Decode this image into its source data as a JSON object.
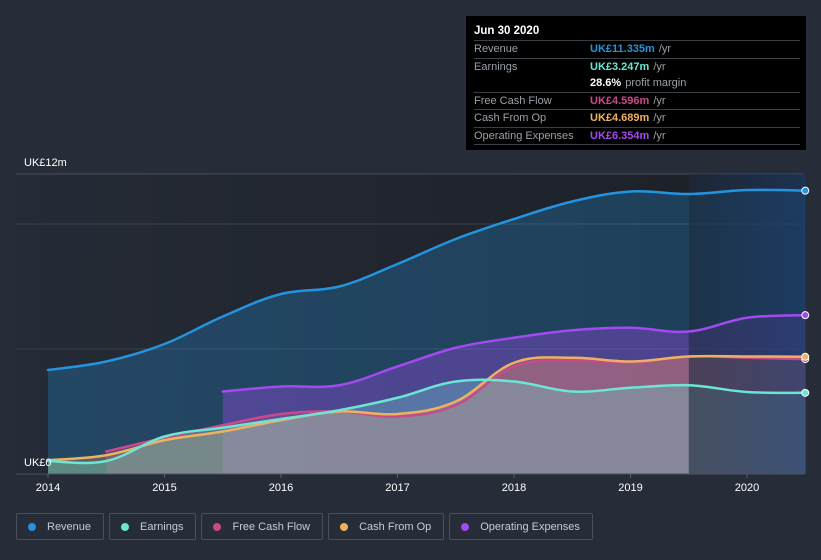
{
  "tooltip": {
    "date": "Jun 30 2020",
    "rows": [
      {
        "label": "Revenue",
        "value": "UK£11.335m",
        "unit": "/yr",
        "color": "#2394df"
      },
      {
        "label": "Earnings",
        "value": "UK£3.247m",
        "unit": "/yr",
        "color": "#6ce5d5"
      },
      {
        "label": "",
        "value": "28.6%",
        "unit": "profit margin",
        "color": "#ffffff"
      },
      {
        "label": "Free Cash Flow",
        "value": "UK£4.596m",
        "unit": "/yr",
        "color": "#c94a8c"
      },
      {
        "label": "Cash From Op",
        "value": "UK£4.689m",
        "unit": "/yr",
        "color": "#eeb25f"
      },
      {
        "label": "Operating Expenses",
        "value": "UK£6.354m",
        "unit": "/yr",
        "color": "#a24af0"
      }
    ]
  },
  "legend": [
    {
      "label": "Revenue",
      "color": "#2394df"
    },
    {
      "label": "Earnings",
      "color": "#6ce5d5"
    },
    {
      "label": "Free Cash Flow",
      "color": "#c94a8c"
    },
    {
      "label": "Cash From Op",
      "color": "#eeb25f"
    },
    {
      "label": "Operating Expenses",
      "color": "#a24af0"
    }
  ],
  "chart_data": {
    "type": "area",
    "title": "",
    "xlabel": "",
    "ylabel": "",
    "y_top_label": "UK£12m",
    "y_zero_label": "UK£0",
    "ylim": [
      0,
      12
    ],
    "xlim": [
      2014.0,
      2020.5
    ],
    "x_ticks": [
      "2014",
      "2015",
      "2016",
      "2017",
      "2018",
      "2019",
      "2020"
    ],
    "gridlines": [
      5,
      10,
      12
    ],
    "highlight_range": [
      2019.5,
      2020.5
    ],
    "series": [
      {
        "name": "Revenue",
        "color": "#2394df",
        "x": [
          2014.0,
          2014.5,
          2015.0,
          2015.5,
          2016.0,
          2016.5,
          2017.0,
          2017.5,
          2018.0,
          2018.5,
          2019.0,
          2019.5,
          2020.0,
          2020.5
        ],
        "values": [
          4.16,
          4.5,
          5.2,
          6.3,
          7.2,
          7.5,
          8.4,
          9.4,
          10.2,
          10.9,
          11.3,
          11.2,
          11.36,
          11.335
        ]
      },
      {
        "name": "Operating Expenses",
        "color": "#a24af0",
        "x": [
          2015.5,
          2016.0,
          2016.5,
          2017.0,
          2017.5,
          2018.0,
          2018.5,
          2019.0,
          2019.5,
          2020.0,
          2020.5
        ],
        "values": [
          3.3,
          3.5,
          3.55,
          4.3,
          5.05,
          5.45,
          5.75,
          5.85,
          5.7,
          6.25,
          6.354
        ]
      },
      {
        "name": "Free Cash Flow",
        "color": "#c94a8c",
        "x": [
          2014.5,
          2015.0,
          2015.5,
          2016.0,
          2016.5,
          2017.0,
          2017.5,
          2018.0,
          2018.5,
          2019.0,
          2019.5,
          2020.0,
          2020.5
        ],
        "values": [
          0.9,
          1.45,
          1.95,
          2.4,
          2.5,
          2.3,
          2.75,
          4.3,
          4.55,
          4.45,
          4.7,
          4.65,
          4.596
        ]
      },
      {
        "name": "Cash From Op",
        "color": "#eeb25f",
        "x": [
          2014.0,
          2014.5,
          2015.0,
          2015.5,
          2016.0,
          2016.5,
          2017.0,
          2017.5,
          2018.0,
          2018.5,
          2019.0,
          2019.5,
          2020.0,
          2020.5
        ],
        "values": [
          0.55,
          0.75,
          1.35,
          1.7,
          2.15,
          2.5,
          2.4,
          2.9,
          4.45,
          4.65,
          4.5,
          4.7,
          4.7,
          4.689
        ]
      },
      {
        "name": "Earnings",
        "color": "#6ce5d5",
        "x": [
          2014.0,
          2014.5,
          2015.0,
          2015.5,
          2016.0,
          2016.5,
          2017.0,
          2017.5,
          2018.0,
          2018.5,
          2019.0,
          2019.5,
          2020.0,
          2020.5
        ],
        "values": [
          0.52,
          0.52,
          1.5,
          1.85,
          2.2,
          2.55,
          3.05,
          3.7,
          3.7,
          3.3,
          3.45,
          3.55,
          3.28,
          3.247
        ]
      }
    ]
  }
}
